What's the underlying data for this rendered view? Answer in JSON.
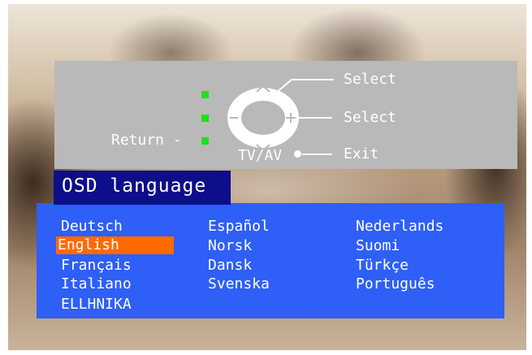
{
  "remote": {
    "select_up_label": "Select",
    "select_right_label": "Select",
    "exit_label": "Exit",
    "return_label": "Return -",
    "tvav_label": "TV/AV"
  },
  "menu": {
    "title": "OSD language",
    "selected": "English",
    "columns": [
      [
        "Deutsch",
        "English",
        "Français",
        "Italiano",
        "ELLHNIKA"
      ],
      [
        "Español",
        "Norsk",
        "Dansk",
        "Svenska"
      ],
      [
        "Nederlands",
        "Suomi",
        "Türkçe",
        "Português"
      ]
    ]
  },
  "colors": {
    "menu_background": "#2e5ff6",
    "title_background": "#0e0e8a",
    "highlight": "#ff6a00",
    "indicator": "#1ee01e",
    "hint_panel": "#b9b9b9"
  }
}
